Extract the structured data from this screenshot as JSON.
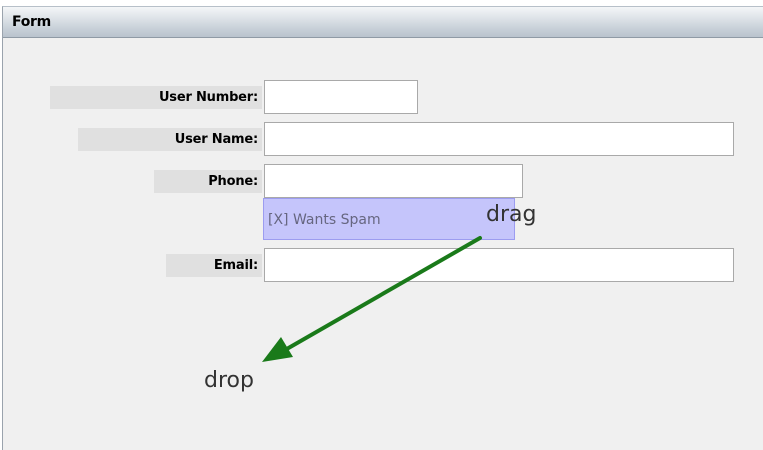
{
  "panel": {
    "title": "Form"
  },
  "fields": {
    "user_number_label": "User Number:",
    "user_name_label": "User Name:",
    "phone_label": "Phone:",
    "email_label": "Email:",
    "user_number_value": "",
    "user_name_value": "",
    "phone_value": "",
    "email_value": ""
  },
  "checkbox": {
    "label": "[X] Wants Spam"
  },
  "annotations": {
    "drag_label": "drag",
    "drop_label": "drop"
  },
  "colors": {
    "arrow": "#1a7a1a",
    "drag_highlight": "#c5c5fb"
  },
  "icons": {
    "arrow": "drag-drop-arrow-icon"
  }
}
